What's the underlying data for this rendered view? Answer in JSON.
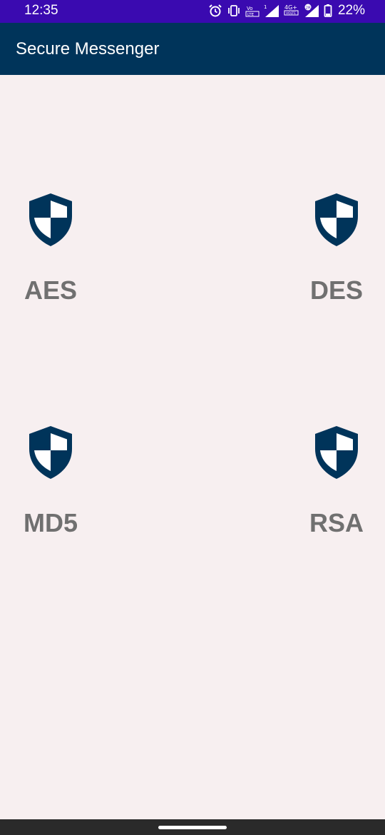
{
  "status_bar": {
    "time": "12:35",
    "battery": "22%",
    "icons": [
      "alarm-icon",
      "vibrate-icon",
      "volte-icon",
      "signal-icon",
      "4g-icon",
      "signal-icon",
      "battery-icon"
    ],
    "background_color": "#3a0ab0"
  },
  "app_bar": {
    "title": "Secure Messenger",
    "background_color": "#00345a"
  },
  "ciphers": [
    {
      "label": "AES",
      "icon": "shield-icon"
    },
    {
      "label": "DES",
      "icon": "shield-icon"
    },
    {
      "label": "MD5",
      "icon": "shield-icon"
    },
    {
      "label": "RSA",
      "icon": "shield-icon"
    }
  ],
  "colors": {
    "accent": "#00345a",
    "label": "#707070",
    "background": "#f7eff0"
  }
}
